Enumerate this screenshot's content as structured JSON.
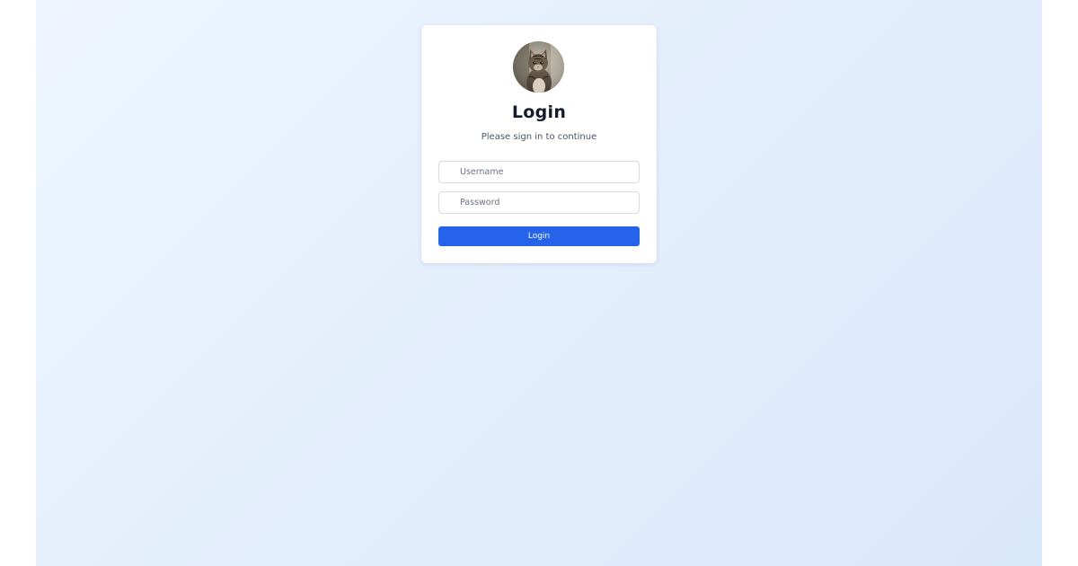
{
  "login_card": {
    "avatar_icon": "cat-avatar",
    "title": "Login",
    "subtitle": "Please sign in to continue",
    "username": {
      "value": "",
      "placeholder": "Username"
    },
    "password": {
      "value": "",
      "placeholder": "Password"
    },
    "login_button_label": "Login"
  },
  "colors": {
    "background": "#e3eefc",
    "card": "#ffffff",
    "primary_button": "#2563eb",
    "title": "#141b2b",
    "subtitle": "#4b5563"
  }
}
